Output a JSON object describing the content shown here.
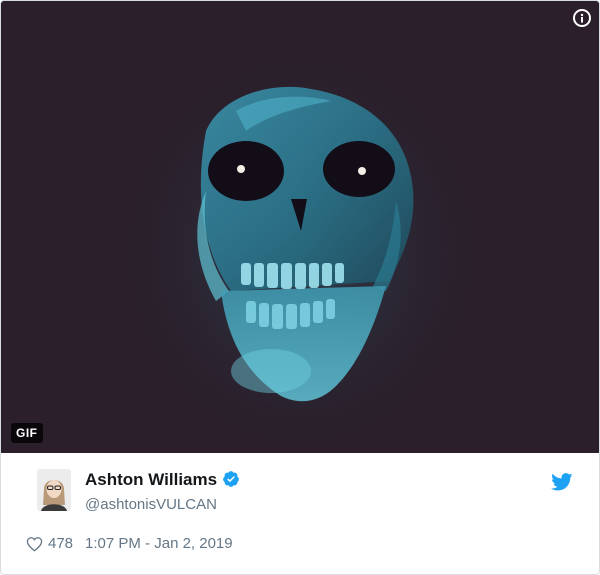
{
  "media": {
    "badge": "GIF",
    "info_icon": "info-icon",
    "background_color": "#2a1f2b",
    "accent_color": "#5fc3d6"
  },
  "author": {
    "name": "Ashton Williams",
    "handle": "@ashtonisVULCAN",
    "verified_icon": "verified-badge-icon",
    "verified_color": "#1da1f2"
  },
  "brand": {
    "icon": "twitter-bird-icon",
    "color": "#1da1f2"
  },
  "meta": {
    "like_icon": "heart-icon",
    "likes": "478",
    "timestamp": "1:07 PM - Jan 2, 2019"
  }
}
